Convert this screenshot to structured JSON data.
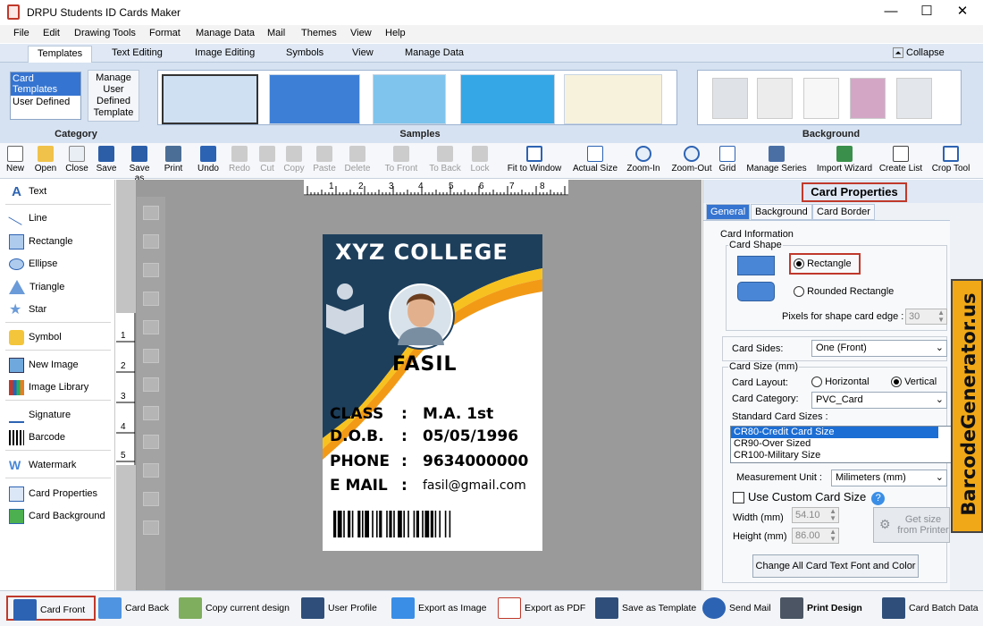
{
  "window": {
    "title": "DRPU Students ID Cards Maker",
    "controls": [
      "—",
      "☐",
      "✕"
    ]
  },
  "menu": [
    "File",
    "Edit",
    "Drawing Tools",
    "Format",
    "Manage Data",
    "Mail",
    "Themes",
    "View",
    "Help"
  ],
  "ribbon_tabs": [
    "Templates",
    "Text Editing",
    "Image Editing",
    "Symbols",
    "View",
    "Manage Data"
  ],
  "collapse_label": "Collapse",
  "category": {
    "items": [
      "Card Templates",
      "User Defined"
    ],
    "button": "Manage User Defined Template",
    "label": "Category"
  },
  "samples_label": "Samples",
  "background_label": "Background",
  "toolbar": [
    "New",
    "Open",
    "Close",
    "Save",
    "Save as",
    "Print",
    "Undo",
    "Redo",
    "Cut",
    "Copy",
    "Paste",
    "Delete",
    "To Front",
    "To Back",
    "Lock",
    "Fit to Window",
    "Actual Size",
    "Zoom-In",
    "Zoom-Out",
    "Grid",
    "Manage Series",
    "Import Wizard",
    "Create List",
    "Crop Tool"
  ],
  "tools": [
    "Text",
    "Line",
    "Rectangle",
    "Ellipse",
    "Triangle",
    "Star",
    "Symbol",
    "New Image",
    "Image Library",
    "Signature",
    "Barcode",
    "Watermark",
    "Card Properties",
    "Card Background"
  ],
  "ruler_h": [
    "1",
    "2",
    "3",
    "4",
    "5",
    "6",
    "7",
    "8"
  ],
  "ruler_v": [
    "1",
    "2",
    "3",
    "4",
    "5"
  ],
  "card": {
    "college": "XYZ COLLEGE",
    "name": "FASIL",
    "rows": [
      {
        "k": "CLASS",
        "v": "M.A. 1st"
      },
      {
        "k": "D.O.B.",
        "v": "05/05/1996"
      },
      {
        "k": "PHONE",
        "v": "9634000000"
      },
      {
        "k": "E MAIL",
        "v": "fasil@gmail.com"
      }
    ],
    "colors": {
      "dark": "#1d3f5c",
      "orange": "#f29a16",
      "yellow": "#f7c21f"
    }
  },
  "props": {
    "title": "Card Properties",
    "tabs": [
      "General",
      "Background",
      "Card Border"
    ],
    "card_information": "Card Information",
    "card_shape": "Card Shape",
    "shape_rect": "Rectangle",
    "shape_rounded": "Rounded Rectangle",
    "pixels_label": "Pixels for shape card edge :",
    "pixels_value": "30",
    "card_sides_label": "Card Sides:",
    "card_sides_value": "One (Front)",
    "card_size": "Card Size (mm)",
    "layout_label": "Card Layout:",
    "layout_h": "Horizontal",
    "layout_v": "Vertical",
    "category_label": "Card Category:",
    "category_value": "PVC_Card",
    "std_sizes_label": "Standard Card Sizes :",
    "std_sizes": [
      "CR80-Credit Card Size",
      "CR90-Over Sized",
      "CR100-Military Size"
    ],
    "unit_label": "Measurement Unit :",
    "unit_value": "Milimeters (mm)",
    "custom_label": "Use Custom Card Size",
    "width_label": "Width  (mm)",
    "width_value": "54.10",
    "height_label": "Height  (mm)",
    "height_value": "86.00",
    "get_size": "Get size from Printer",
    "change_font": "Change All Card Text Font and Color"
  },
  "status": [
    "Card Front",
    "Card Back",
    "Copy current design",
    "User Profile",
    "Export as Image",
    "Export as PDF",
    "Save as Template",
    "Send Mail",
    "Print Design",
    "Card Batch Data"
  ],
  "watermark": "BarcodeGenerator.us"
}
